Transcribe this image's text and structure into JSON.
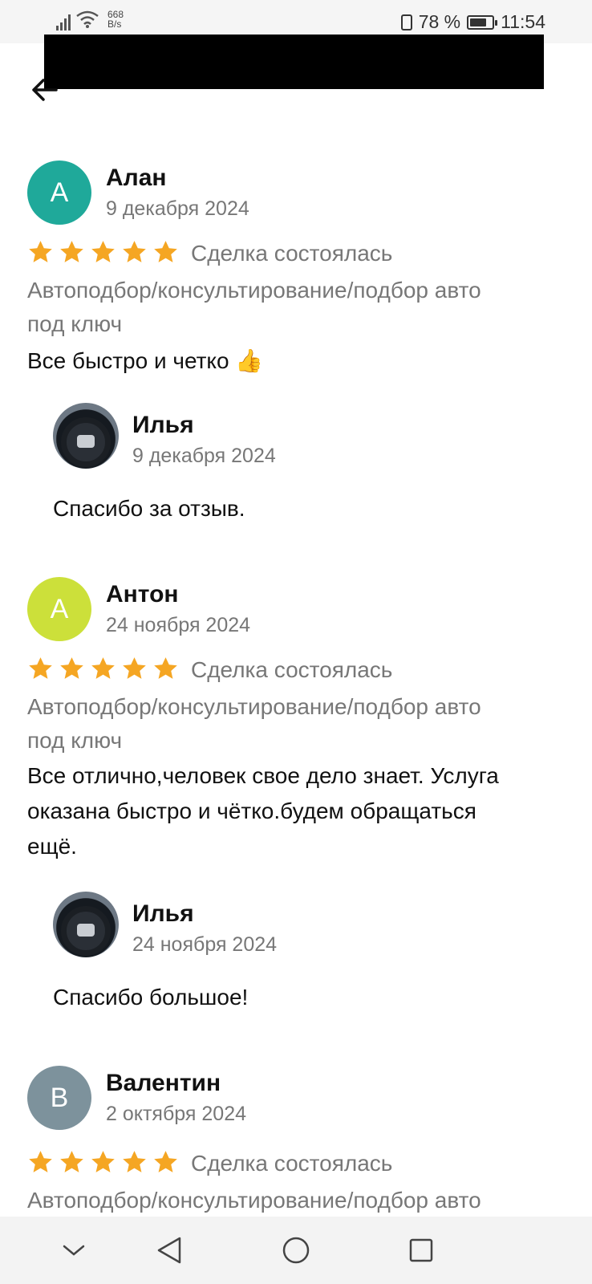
{
  "status_bar": {
    "net_speed_value": "668",
    "net_speed_unit": "B/s",
    "battery": "78 %",
    "battery_level": 0.78,
    "time": "11:54"
  },
  "reviews": [
    {
      "initial": "А",
      "avatar_color": "#1fa99a",
      "name": "Алан",
      "date": "9 декабря 2024",
      "rating": 5,
      "deal": "Сделка состоялась",
      "category_line1": "Автоподбор/консультирование/подбор авто",
      "category_line2": "под ключ",
      "text": "Все быстро и четко 👍",
      "reply": {
        "name": "Илья",
        "date": "9 декабря 2024",
        "text": "Спасибо за отзыв."
      }
    },
    {
      "initial": "А",
      "avatar_color": "#cce03a",
      "name": "Антон",
      "date": "24 ноября 2024",
      "rating": 5,
      "deal": "Сделка состоялась",
      "category_line1": "Автоподбор/консультирование/подбор авто",
      "category_line2": "под ключ",
      "text_line1": "Все отлично,человек свое дело знает. Услуга",
      "text_line2": "оказана быстро и чётко.будем обращаться",
      "text_line3": "ещё.",
      "reply": {
        "name": "Илья",
        "date": "24 ноября 2024",
        "text": "Спасибо большое!"
      }
    },
    {
      "initial": "В",
      "avatar_color": "#7d929c",
      "name": "Валентин",
      "date": "2 октября 2024",
      "rating": 5,
      "deal": "Сделка состоялась",
      "category_line1": "Автоподбор/консультирование/подбор авто"
    }
  ],
  "colors": {
    "star": "#f5a623",
    "muted_text": "#777777"
  },
  "icons": {
    "back": "arrow-left-icon",
    "nav_down": "chevron-down-icon",
    "nav_back": "triangle-back-icon",
    "nav_home": "circle-home-icon",
    "nav_recent": "square-recent-icon"
  }
}
